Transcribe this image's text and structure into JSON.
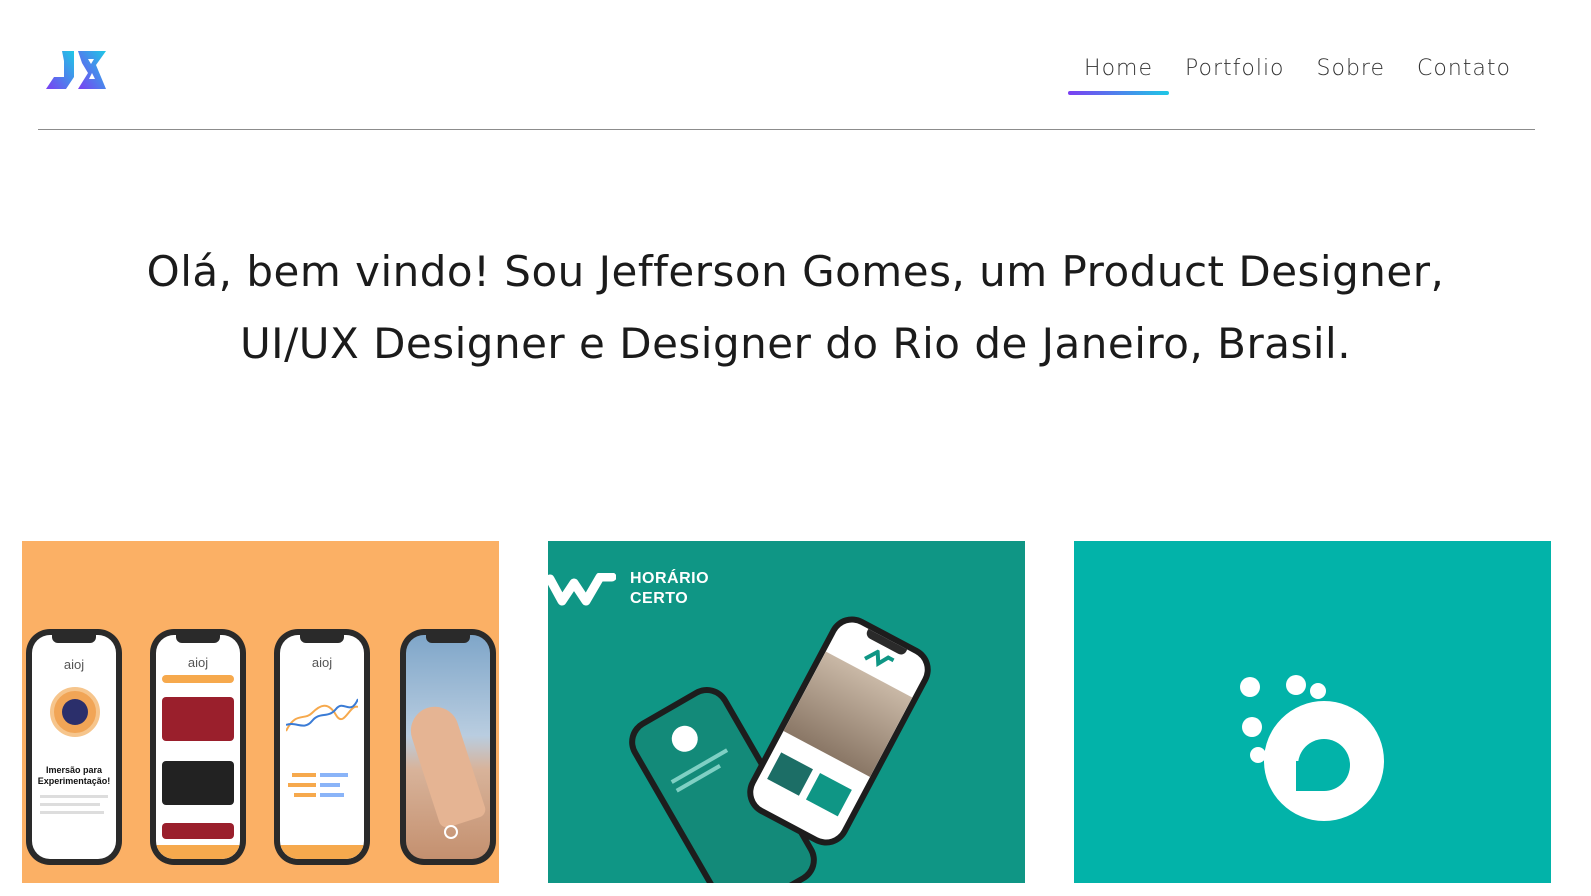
{
  "header": {
    "logo_name": "JG monogram logo",
    "nav": [
      {
        "label": "Home",
        "active": true
      },
      {
        "label": "Portfolio",
        "active": false
      },
      {
        "label": "Sobre",
        "active": false
      },
      {
        "label": "Contato",
        "active": false
      }
    ]
  },
  "hero": {
    "line1": "Olá, bem vindo! Sou Jefferson Gomes, um Product Designer,",
    "line2": "UI/UX Designer e Designer do Rio de Janeiro, Brasil."
  },
  "portfolio": {
    "cards": [
      {
        "name": "aioj",
        "brand_text": "aioj",
        "headline": "Imersão para Experimentação!",
        "color": "#fbb065"
      },
      {
        "name": "horario-certo",
        "title_line1": "HORÁRIO",
        "title_line2": "CERTO",
        "color": "#0f9685"
      },
      {
        "name": "drop-logo",
        "color": "#02b3a9"
      }
    ]
  },
  "colors": {
    "accent_start": "#7b3ff2",
    "accent_end": "#1ec8e6"
  }
}
